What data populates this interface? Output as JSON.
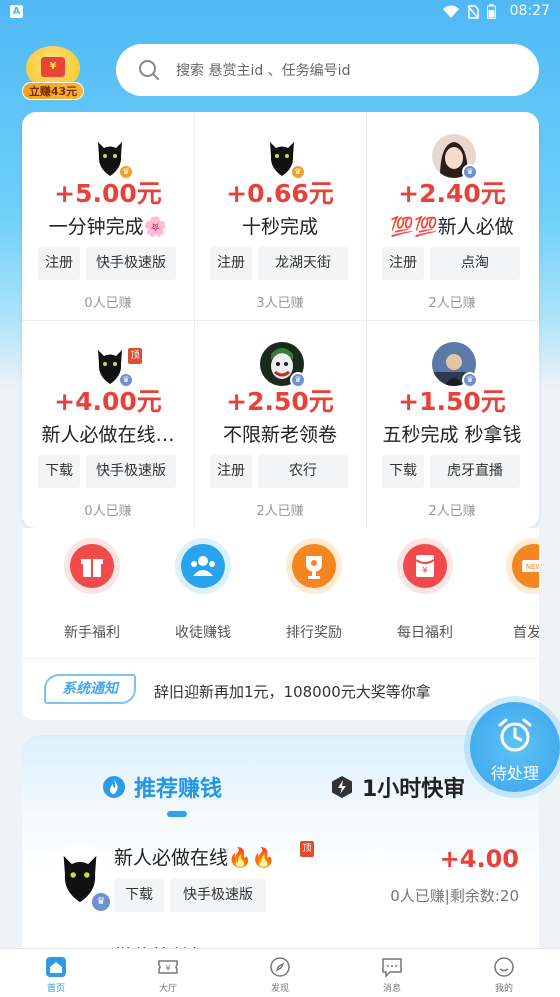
{
  "status_bar": {
    "app_letter": "A",
    "time": "08:27"
  },
  "header": {
    "badge_label": "立赚43元",
    "badge_symbol": "¥",
    "search_placeholder": "搜索 悬赏主id 、任务编号id"
  },
  "tasks_grid": [
    {
      "amount": "+5.00元",
      "title": "一分钟完成🌸",
      "tags": [
        "注册",
        "快手极速版"
      ],
      "earned": "0人已赚",
      "crown": "gold",
      "pinned": false
    },
    {
      "amount": "+0.66元",
      "title": "十秒完成",
      "tags": [
        "注册",
        "龙湖天街"
      ],
      "earned": "3人已赚",
      "crown": "gold",
      "pinned": false
    },
    {
      "amount": "+2.40元",
      "title": "💯💯新人必做",
      "tags": [
        "注册",
        "点淘"
      ],
      "earned": "2人已赚",
      "crown": "blue",
      "pinned": false
    },
    {
      "amount": "+4.00元",
      "title": "新人必做在线…",
      "tags": [
        "下载",
        "快手极速版"
      ],
      "earned": "0人已赚",
      "crown": "blue",
      "pinned": true
    },
    {
      "amount": "+2.50元",
      "title": "不限新老领卷",
      "tags": [
        "注册",
        "农行"
      ],
      "earned": "2人已赚",
      "crown": "blue",
      "pinned": false
    },
    {
      "amount": "+1.50元",
      "title": "五秒完成 秒拿钱",
      "tags": [
        "下载",
        "虎牙直播"
      ],
      "earned": "2人已赚",
      "crown": "blue",
      "pinned": false
    }
  ],
  "pin_label": "顶",
  "menu": [
    {
      "label": "新手福利",
      "icon": "gift-icon",
      "color": "#f04a4a"
    },
    {
      "label": "收徒赚钱",
      "icon": "people-icon",
      "color": "#2aa3ef"
    },
    {
      "label": "排行奖励",
      "icon": "trophy-icon",
      "color": "#f4851f"
    },
    {
      "label": "每日福利",
      "icon": "red-envelope-icon",
      "color": "#f04a4a"
    },
    {
      "label": "首发新",
      "icon": "new-icon",
      "color": "#f4851f"
    }
  ],
  "notice": {
    "tag": "系统通知",
    "text": "辞旧迎新再加1元，108000元大奖等你拿"
  },
  "floating_button": {
    "label": "待处理"
  },
  "recommend": {
    "tab_active": "推荐赚钱",
    "tab_other": "1小时快审",
    "task": {
      "title": "新人必做在线🔥🔥",
      "pin": "顶",
      "amount": "+4.00",
      "tags": [
        "下载",
        "快手极速版"
      ],
      "earned": "0人已赚|剩余数:20"
    },
    "next_partial": "微信简单扫码"
  },
  "tabbar": [
    {
      "label": "首页",
      "icon": "home-icon",
      "active": true
    },
    {
      "label": "大厅",
      "icon": "ticket-icon",
      "active": false
    },
    {
      "label": "发现",
      "icon": "compass-icon",
      "active": false
    },
    {
      "label": "消息",
      "icon": "message-icon",
      "active": false
    },
    {
      "label": "我的",
      "icon": "profile-icon",
      "active": false
    }
  ],
  "colors": {
    "accent": "#2e9ae8",
    "amount": "#e8413a",
    "badge": "#f7a21b"
  }
}
